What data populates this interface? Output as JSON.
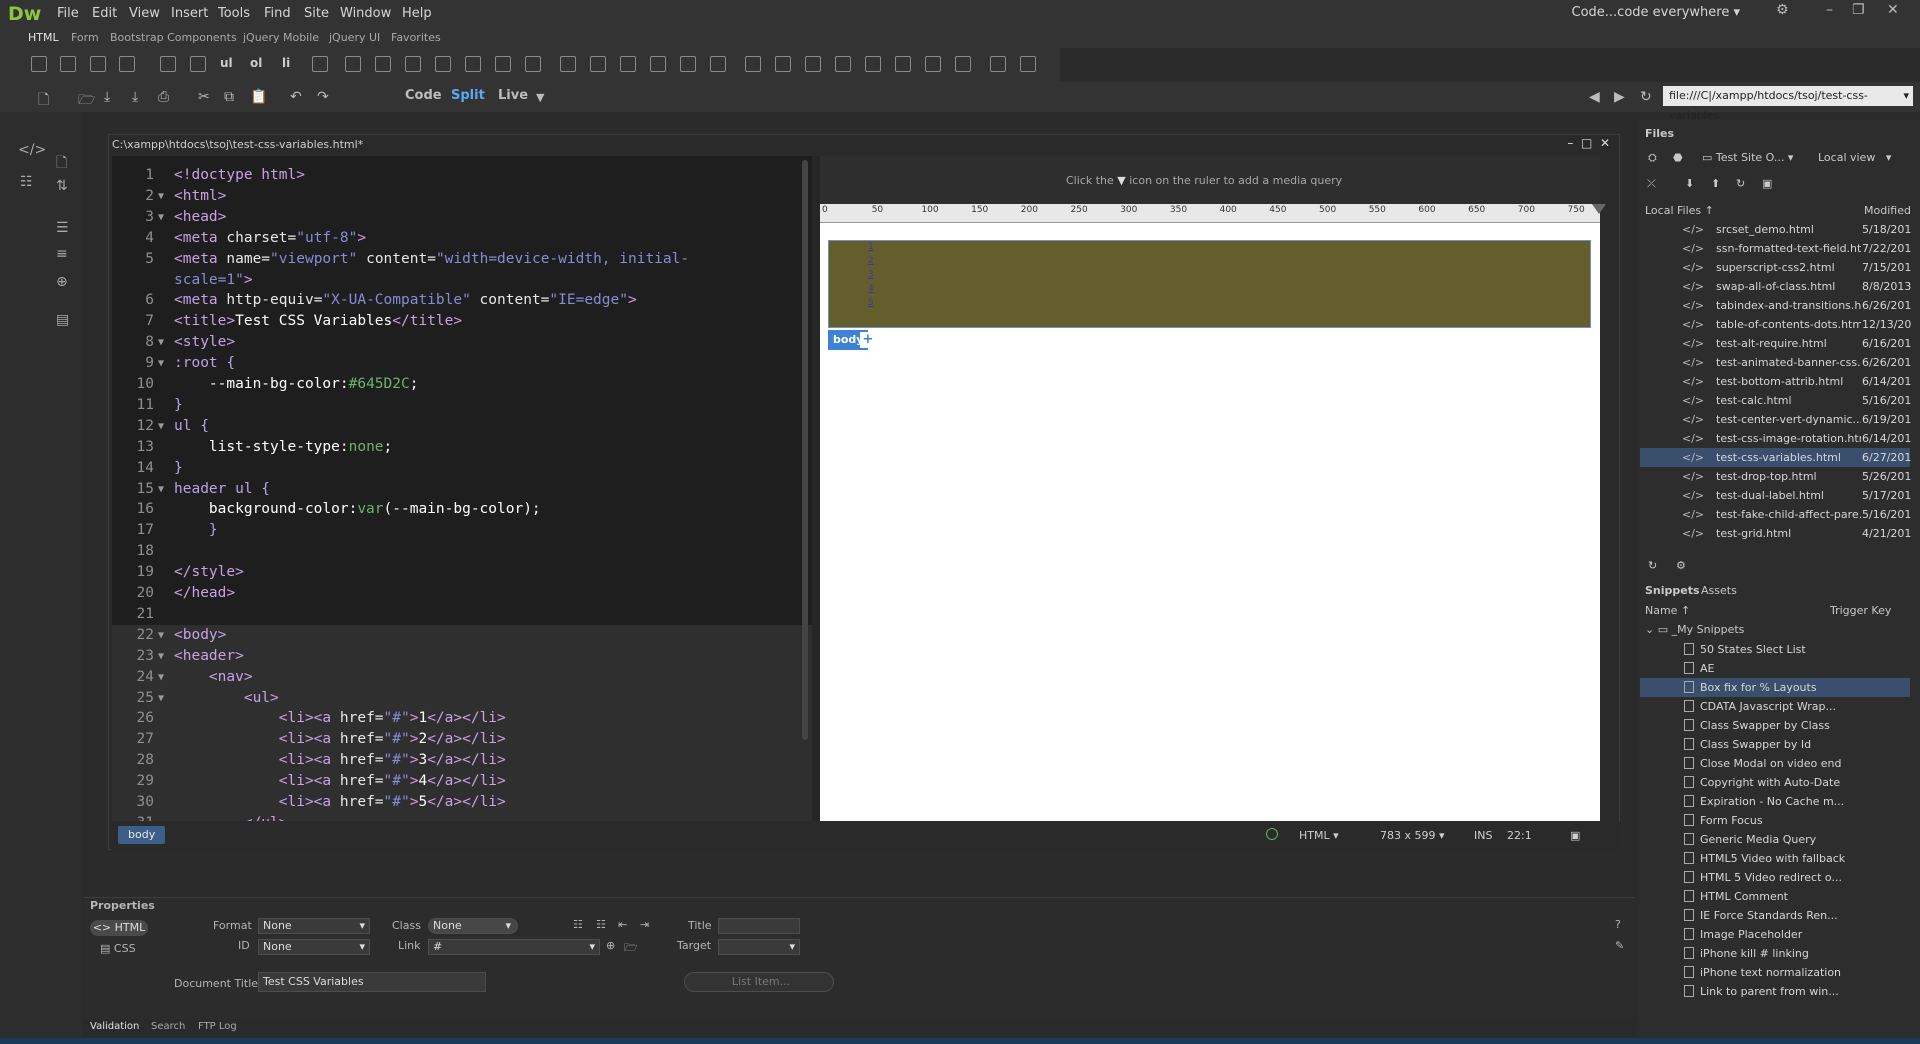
{
  "app": {
    "logo": "Dw",
    "workspace": "Code...code everywhere"
  },
  "menu": [
    "File",
    "Edit",
    "View",
    "Insert",
    "Tools",
    "Find",
    "Site",
    "Window",
    "Help"
  ],
  "insert_tabs": [
    "HTML",
    "Form",
    "Bootstrap Components",
    "jQuery Mobile",
    "jQuery UI",
    "Favorites"
  ],
  "view_buttons": {
    "code": "Code",
    "split": "Split",
    "live": "Live"
  },
  "url": "file:///C|/xampp/htdocs/tsoj/test-css-variables",
  "document": {
    "title_path": "C:\\xampp\\htdocs\\tsoj\\test-css-variables.html*",
    "code_lines": [
      {
        "n": "1",
        "fold": false,
        "parts": [
          [
            "tag",
            "<!doctype html>"
          ]
        ]
      },
      {
        "n": "2",
        "fold": true,
        "parts": [
          [
            "tag",
            "<html>"
          ]
        ]
      },
      {
        "n": "3",
        "fold": true,
        "parts": [
          [
            "tag",
            "<head>"
          ]
        ]
      },
      {
        "n": "4",
        "fold": false,
        "parts": [
          [
            "tag",
            "<meta "
          ],
          [
            "attr",
            "charset="
          ],
          [
            "str",
            "\"utf-8\""
          ],
          [
            "tag",
            ">"
          ]
        ]
      },
      {
        "n": "5",
        "fold": false,
        "parts": [
          [
            "tag",
            "<meta "
          ],
          [
            "attr",
            "name="
          ],
          [
            "str",
            "\"viewport\""
          ],
          [
            "attr",
            " content="
          ],
          [
            "str",
            "\"width=device-width, initial-"
          ]
        ]
      },
      {
        "n": "",
        "fold": false,
        "parts": [
          [
            "str",
            "scale=1\""
          ],
          [
            "tag",
            ">"
          ]
        ]
      },
      {
        "n": "6",
        "fold": false,
        "parts": [
          [
            "tag",
            "<meta "
          ],
          [
            "attr",
            "http-equiv="
          ],
          [
            "str",
            "\"X-UA-Compatible\""
          ],
          [
            "attr",
            " content="
          ],
          [
            "str",
            "\"IE=edge\""
          ],
          [
            "tag",
            ">"
          ]
        ]
      },
      {
        "n": "7",
        "fold": false,
        "parts": [
          [
            "tag",
            "<title>"
          ],
          [
            "txt",
            "Test CSS Variables"
          ],
          [
            "tag",
            "</title>"
          ]
        ]
      },
      {
        "n": "8",
        "fold": true,
        "parts": [
          [
            "tag",
            "<style>"
          ]
        ]
      },
      {
        "n": "9",
        "fold": true,
        "parts": [
          [
            "sel",
            ":root {"
          ]
        ]
      },
      {
        "n": "10",
        "fold": false,
        "parts": [
          [
            "txt",
            "    --main-bg-color:"
          ],
          [
            "cssv",
            "#645D2C"
          ],
          [
            "txt",
            ";"
          ]
        ]
      },
      {
        "n": "11",
        "fold": false,
        "parts": [
          [
            "sel",
            "}"
          ]
        ]
      },
      {
        "n": "12",
        "fold": true,
        "parts": [
          [
            "sel",
            "ul {"
          ]
        ]
      },
      {
        "n": "13",
        "fold": false,
        "parts": [
          [
            "txt",
            "    list-style-type:"
          ],
          [
            "cssv",
            "none"
          ],
          [
            "txt",
            ";"
          ]
        ]
      },
      {
        "n": "14",
        "fold": false,
        "parts": [
          [
            "sel",
            "}"
          ]
        ]
      },
      {
        "n": "15",
        "fold": true,
        "parts": [
          [
            "sel",
            "header ul {"
          ]
        ]
      },
      {
        "n": "16",
        "fold": false,
        "parts": [
          [
            "txt",
            "    background-color:"
          ],
          [
            "cssv",
            "var"
          ],
          [
            "txt",
            "(--main-bg-color);"
          ]
        ]
      },
      {
        "n": "17",
        "fold": false,
        "parts": [
          [
            "sel",
            "    }"
          ]
        ]
      },
      {
        "n": "18",
        "fold": false,
        "parts": []
      },
      {
        "n": "19",
        "fold": false,
        "parts": [
          [
            "tag",
            "</style>"
          ]
        ]
      },
      {
        "n": "20",
        "fold": false,
        "parts": [
          [
            "tag",
            "</head>"
          ]
        ]
      },
      {
        "n": "21",
        "fold": false,
        "parts": []
      },
      {
        "n": "22",
        "fold": true,
        "hl": true,
        "parts": [
          [
            "tag",
            "<body>"
          ]
        ]
      },
      {
        "n": "23",
        "fold": true,
        "hl": true,
        "parts": [
          [
            "tag",
            "<header>"
          ]
        ]
      },
      {
        "n": "24",
        "fold": true,
        "hl": true,
        "parts": [
          [
            "tag",
            "    <nav>"
          ]
        ]
      },
      {
        "n": "25",
        "fold": true,
        "hl": true,
        "parts": [
          [
            "tag",
            "        <ul>"
          ]
        ]
      },
      {
        "n": "26",
        "fold": false,
        "hl": true,
        "parts": [
          [
            "tag",
            "            <li><a "
          ],
          [
            "attr",
            "href="
          ],
          [
            "str",
            "\"#\""
          ],
          [
            "tag",
            ">"
          ],
          [
            "txt",
            "1"
          ],
          [
            "tag",
            "</a></li>"
          ]
        ]
      },
      {
        "n": "27",
        "fold": false,
        "hl": true,
        "parts": [
          [
            "tag",
            "            <li><a "
          ],
          [
            "attr",
            "href="
          ],
          [
            "str",
            "\"#\""
          ],
          [
            "tag",
            ">"
          ],
          [
            "txt",
            "2"
          ],
          [
            "tag",
            "</a></li>"
          ]
        ]
      },
      {
        "n": "28",
        "fold": false,
        "hl": true,
        "parts": [
          [
            "tag",
            "            <li><a "
          ],
          [
            "attr",
            "href="
          ],
          [
            "str",
            "\"#\""
          ],
          [
            "tag",
            ">"
          ],
          [
            "txt",
            "3"
          ],
          [
            "tag",
            "</a></li>"
          ]
        ]
      },
      {
        "n": "29",
        "fold": false,
        "hl": true,
        "parts": [
          [
            "tag",
            "            <li><a "
          ],
          [
            "attr",
            "href="
          ],
          [
            "str",
            "\"#\""
          ],
          [
            "tag",
            ">"
          ],
          [
            "txt",
            "4"
          ],
          [
            "tag",
            "</a></li>"
          ]
        ]
      },
      {
        "n": "30",
        "fold": false,
        "hl": true,
        "parts": [
          [
            "tag",
            "            <li><a "
          ],
          [
            "attr",
            "href="
          ],
          [
            "str",
            "\"#\""
          ],
          [
            "tag",
            ">"
          ],
          [
            "txt",
            "5"
          ],
          [
            "tag",
            "</a></li>"
          ]
        ]
      },
      {
        "n": "31",
        "fold": false,
        "hl": true,
        "parts": [
          [
            "tag",
            "        </ul>"
          ]
        ]
      }
    ]
  },
  "live": {
    "media_query_hint_a": "Click the",
    "media_query_hint_b": "icon on the ruler to add a media query",
    "ruler_ticks": [
      "0",
      "50",
      "100",
      "150",
      "200",
      "250",
      "300",
      "350",
      "400",
      "450",
      "500",
      "550",
      "600",
      "650",
      "700",
      "750"
    ],
    "nav_items": [
      "1",
      "2",
      "3",
      "4",
      "5"
    ],
    "body_badge": "body",
    "header_bg": "#645D2C"
  },
  "status": {
    "tag": "body",
    "doc_type": "HTML",
    "size": "783 x 599",
    "mode": "INS",
    "position": "22:1"
  },
  "properties": {
    "title": "Properties",
    "html_label": "HTML",
    "css_label": "CSS",
    "format_label": "Format",
    "format_value": "None",
    "id_label": "ID",
    "id_value": "None",
    "class_label": "Class",
    "class_value": "None",
    "link_label": "Link",
    "link_value": "#",
    "title_label": "Title",
    "target_label": "Target",
    "doc_title_label": "Document Title",
    "doc_title_value": "Test CSS Variables",
    "list_item_btn": "List Item..."
  },
  "bottom_tabs": [
    "Validation",
    "Search",
    "FTP Log"
  ],
  "files": {
    "panel_title": "Files",
    "site": "Test Site O...",
    "view": "Local view",
    "col_local": "Local Files",
    "col_modified": "Modified",
    "rows": [
      {
        "name": "srcset_demo.html",
        "date": "5/18/201"
      },
      {
        "name": "ssn-formatted-text-field.html",
        "date": "7/22/201"
      },
      {
        "name": "superscript-css2.html",
        "date": "7/15/201"
      },
      {
        "name": "swap-all-of-class.html",
        "date": "8/8/2013"
      },
      {
        "name": "tabindex-and-transitions.html",
        "date": "6/26/201"
      },
      {
        "name": "table-of-contents-dots.html",
        "date": "12/13/20"
      },
      {
        "name": "test-alt-require.html",
        "date": "6/16/201"
      },
      {
        "name": "test-animated-banner-css....",
        "date": "6/26/201"
      },
      {
        "name": "test-bottom-attrib.html",
        "date": "6/14/201"
      },
      {
        "name": "test-calc.html",
        "date": "5/16/201"
      },
      {
        "name": "test-center-vert-dynamic....",
        "date": "6/19/201"
      },
      {
        "name": "test-css-image-rotation.html",
        "date": "6/14/201"
      },
      {
        "name": "test-css-variables.html",
        "date": "6/27/201",
        "selected": true
      },
      {
        "name": "test-drop-top.html",
        "date": "5/26/201"
      },
      {
        "name": "test-dual-label.html",
        "date": "5/17/201"
      },
      {
        "name": "test-fake-child-affect-pare...",
        "date": "5/16/201"
      },
      {
        "name": "test-grid.html",
        "date": "4/21/201"
      }
    ]
  },
  "snippets": {
    "tab_snippets": "Snippets",
    "tab_assets": "Assets",
    "col_name": "Name",
    "col_trigger": "Trigger Key",
    "folder": "_My Snippets",
    "items": [
      {
        "name": "50 States Slect List"
      },
      {
        "name": "AE"
      },
      {
        "name": "Box fix for % Layouts",
        "selected": true
      },
      {
        "name": "CDATA Javascript Wrap..."
      },
      {
        "name": "Class Swapper by Class"
      },
      {
        "name": "Class Swapper by Id"
      },
      {
        "name": "Close Modal on video end"
      },
      {
        "name": "Copyright with Auto-Date"
      },
      {
        "name": "Expiration - No Cache m..."
      },
      {
        "name": "Form Focus"
      },
      {
        "name": "Generic Media Query"
      },
      {
        "name": "HTML5 Video with fallback"
      },
      {
        "name": "HTML 5 Video redirect o..."
      },
      {
        "name": "HTML Comment"
      },
      {
        "name": "IE Force Standards Ren..."
      },
      {
        "name": "Image Placeholder"
      },
      {
        "name": "iPhone kill # linking"
      },
      {
        "name": "iPhone text normalization"
      },
      {
        "name": "Link to parent from win..."
      }
    ]
  }
}
